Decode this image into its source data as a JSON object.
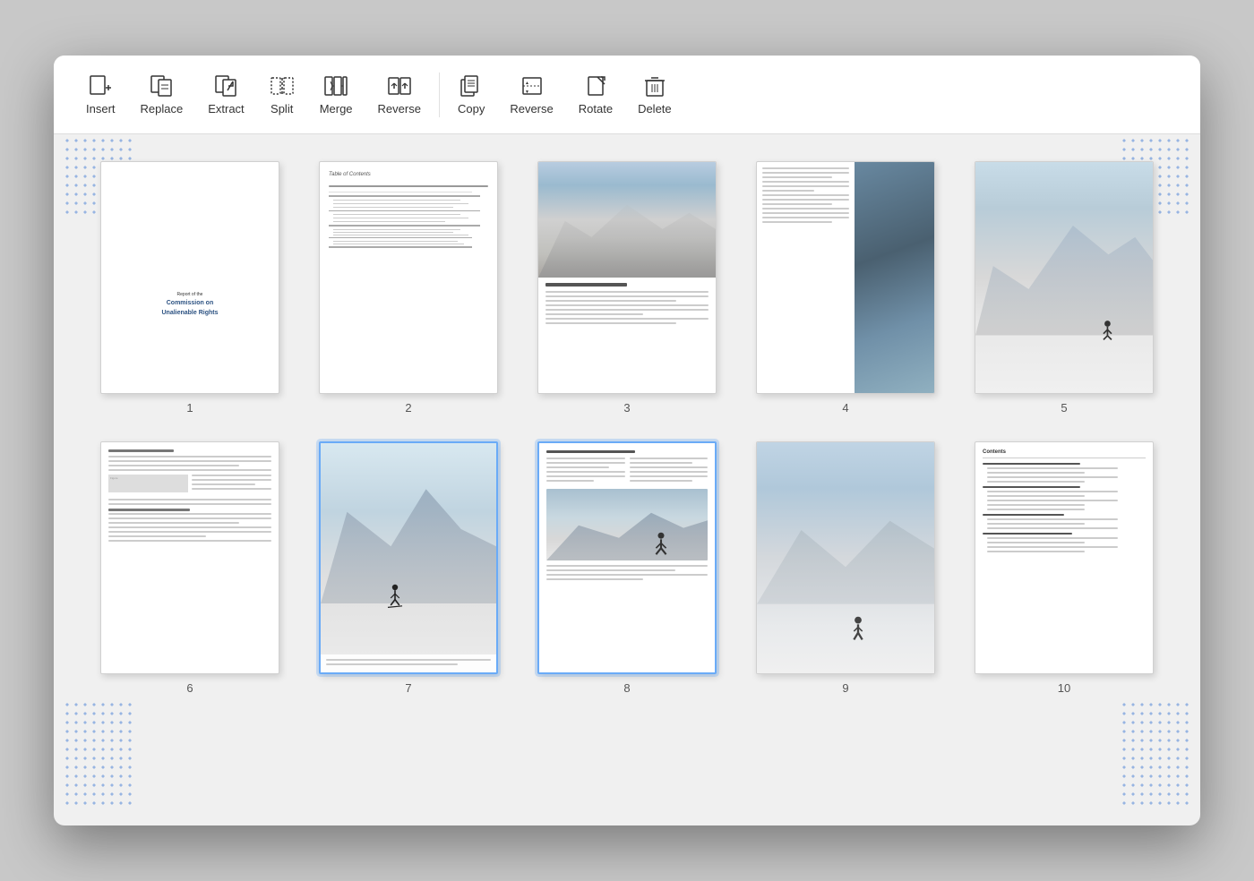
{
  "toolbar": {
    "items": [
      {
        "id": "insert",
        "label": "Insert",
        "icon": "insert-icon"
      },
      {
        "id": "replace",
        "label": "Replace",
        "icon": "replace-icon"
      },
      {
        "id": "extract",
        "label": "Extract",
        "icon": "extract-icon"
      },
      {
        "id": "split",
        "label": "Split",
        "icon": "split-icon"
      },
      {
        "id": "merge",
        "label": "Merge",
        "icon": "merge-icon"
      },
      {
        "id": "reverse1",
        "label": "Reverse",
        "icon": "reverse1-icon"
      },
      {
        "id": "copy",
        "label": "Copy",
        "icon": "copy-icon"
      },
      {
        "id": "reverse2",
        "label": "Reverse",
        "icon": "reverse2-icon"
      },
      {
        "id": "rotate",
        "label": "Rotate",
        "icon": "rotate-icon"
      },
      {
        "id": "delete",
        "label": "Delete",
        "icon": "delete-icon"
      }
    ]
  },
  "pages": [
    {
      "number": "1",
      "type": "cover"
    },
    {
      "number": "2",
      "type": "toc"
    },
    {
      "number": "3",
      "type": "mountain-top"
    },
    {
      "number": "4",
      "type": "two-col-img-right"
    },
    {
      "number": "5",
      "type": "snow-skier"
    },
    {
      "number": "6",
      "type": "text-dense"
    },
    {
      "number": "7",
      "type": "skier-scene",
      "selected": true
    },
    {
      "number": "8",
      "type": "text-mountain",
      "selected": true
    },
    {
      "number": "9",
      "type": "snow-plain"
    },
    {
      "number": "10",
      "type": "contents"
    }
  ],
  "colors": {
    "accent": "#6aabf7",
    "selected_border": "#6aabf7",
    "toolbar_bg": "#ffffff",
    "page_bg": "#ffffff",
    "text_primary": "#333333",
    "cover_blue": "#2c5282"
  }
}
